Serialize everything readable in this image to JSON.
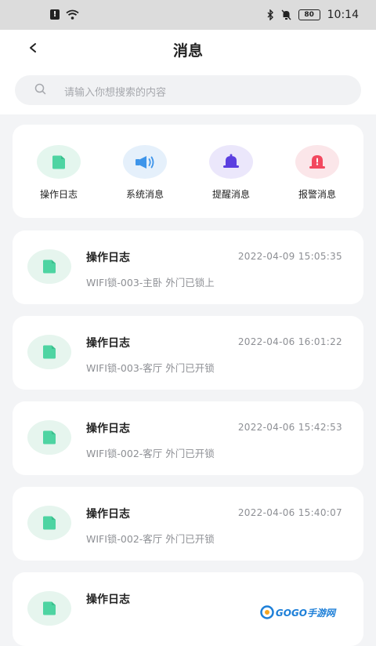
{
  "status": {
    "battery": "80",
    "time": "10:14"
  },
  "header": {
    "title": "消息"
  },
  "search": {
    "placeholder": "请输入你想搜索的内容"
  },
  "categories": [
    {
      "label": "操作日志",
      "icon": "log-icon",
      "bg": "#e4f6ee",
      "color": "#4ed4a2"
    },
    {
      "label": "系统消息",
      "icon": "speaker-icon",
      "bg": "#e5f0fb",
      "color": "#3e95ea"
    },
    {
      "label": "提醒消息",
      "icon": "bell-icon",
      "bg": "#ebe7fb",
      "color": "#5b3fe0"
    },
    {
      "label": "报警消息",
      "icon": "alarm-icon",
      "bg": "#fbe6e9",
      "color": "#f2485e"
    }
  ],
  "messages": [
    {
      "title": "操作日志",
      "time": "2022-04-09 15:05:35",
      "desc": "WIFI锁-003-主卧 外门已锁上"
    },
    {
      "title": "操作日志",
      "time": "2022-04-06 16:01:22",
      "desc": "WIFI锁-003-客厅 外门已开锁"
    },
    {
      "title": "操作日志",
      "time": "2022-04-06 15:42:53",
      "desc": "WIFI锁-002-客厅 外门已开锁"
    },
    {
      "title": "操作日志",
      "time": "2022-04-06 15:40:07",
      "desc": "WIFI锁-002-客厅 外门已开锁"
    },
    {
      "title": "操作日志",
      "time": "",
      "desc": ""
    }
  ],
  "watermark": {
    "text": "GOGO手游网"
  }
}
